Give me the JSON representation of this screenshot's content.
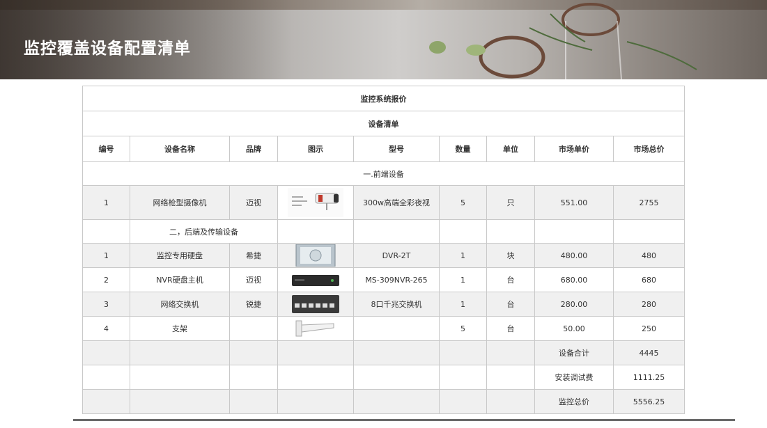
{
  "header": {
    "title": "监控覆盖设备配置清单"
  },
  "table": {
    "title": "监控系统报价",
    "subtitle": "设备清单",
    "columns": [
      "编号",
      "设备名称",
      "品牌",
      "图示",
      "型号",
      "数量",
      "单位",
      "市场单价",
      "市场总价"
    ],
    "section1": "一.前端设备",
    "row1": {
      "no": "1",
      "name": "网络枪型摄像机",
      "brand": "迈视",
      "image": "bullet-camera-image",
      "model": "300w高端全彩夜视",
      "qty": "5",
      "unit": "只",
      "price": "551.00",
      "total": "2755"
    },
    "section2": "二，后端及传输设备",
    "rows": [
      {
        "no": "1",
        "name": "监控专用硬盘",
        "brand": "希捷",
        "image": "hard-disk-image",
        "model": "DVR-2T",
        "qty": "1",
        "unit": "块",
        "price": "480.00",
        "total": "480"
      },
      {
        "no": "2",
        "name": "NVR硬盘主机",
        "brand": "迈视",
        "image": "nvr-recorder-image",
        "model": "MS-309NVR-265",
        "qty": "1",
        "unit": "台",
        "price": "680.00",
        "total": "680"
      },
      {
        "no": "3",
        "name": "网络交换机",
        "brand": "锐捷",
        "image": "network-switch-image",
        "model": "8口千兆交换机",
        "qty": "1",
        "unit": "台",
        "price": "280.00",
        "total": "280"
      },
      {
        "no": "4",
        "name": "支架",
        "brand": "",
        "image": "wall-bracket-image",
        "model": "",
        "qty": "5",
        "unit": "台",
        "price": "50.00",
        "total": "250"
      }
    ],
    "summary": {
      "equipment_total_label": "设备合计",
      "equipment_total": "4445",
      "install_label": "安装调试费",
      "install_fee": "1111.25",
      "grand_total_label": "监控总价",
      "grand_total": "5556.25"
    }
  }
}
